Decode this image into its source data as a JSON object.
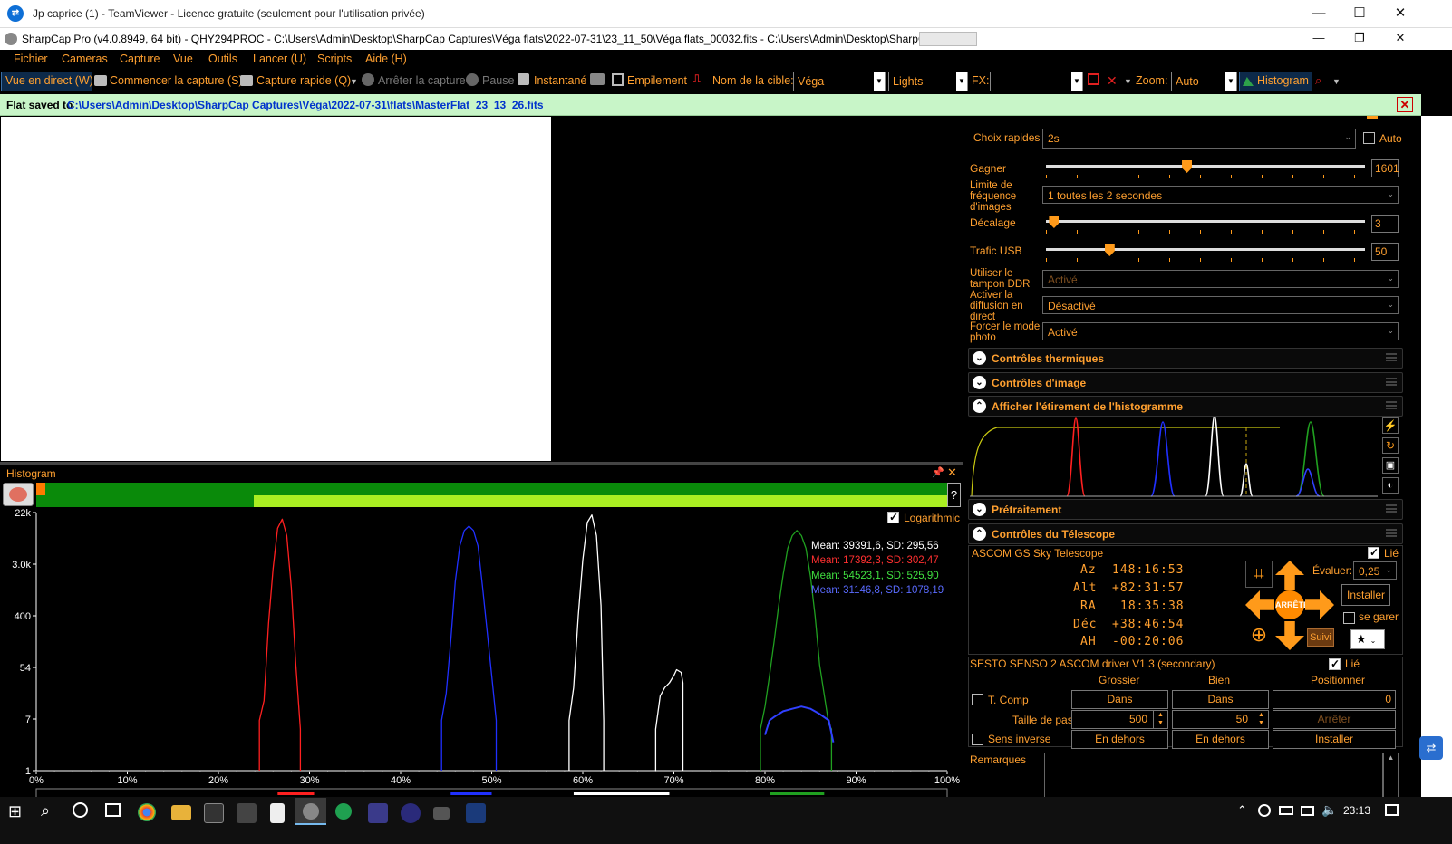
{
  "teamviewer": {
    "title": "Jp caprice (1) - TeamViewer - Licence gratuite (seulement pour l'utilisation privée)",
    "min": "—",
    "max": "☐",
    "close": "✕"
  },
  "sharpcap": {
    "title": "SharpCap Pro (v4.0.8949, 64 bit) - QHY294PROC - C:\\Users\\Admin\\Desktop\\SharpCap Captures\\Véga flats\\2022-07-31\\23_11_50\\Véga flats_00032.fits - C:\\Users\\Admin\\Desktop\\SharpCap Captu"
  },
  "menu": [
    "Fichier",
    "Cameras",
    "Capture",
    "Vue",
    "Outils",
    "Lancer (U)",
    "Scripts",
    "Aide (H)"
  ],
  "toolbar": {
    "live": "Vue en direct (W)",
    "start": "Commencer la capture (S)",
    "quick": "Capture rapide (Q)",
    "stop": "Arrêter la capture",
    "pause": "Pause",
    "snapshot": "Instantané",
    "stack": "Empilement",
    "target_label": "Nom de la cible:",
    "target_value": "Véga",
    "frame_type": "Lights",
    "fx_label": "FX:",
    "fx_value": "",
    "zoom_label": "Zoom:",
    "zoom_value": "Auto",
    "histogram": "Histogram"
  },
  "notification": {
    "prefix": "Flat saved to",
    "path": "C:\\Users\\Admin\\Desktop\\SharpCap Captures\\Véga\\2022-07-31\\flats\\MasterFlat_23_13_26.fits"
  },
  "histogram": {
    "title": "Histogram",
    "logarithmic": "Logarithmic",
    "stats": [
      {
        "text": "Mean: 39391,6, SD: 295,56",
        "color": "#ffffff"
      },
      {
        "text": "Mean: 17392,3, SD: 302,47",
        "color": "#ff3030"
      },
      {
        "text": "Mean: 54523,1, SD: 525,90",
        "color": "#40e040"
      },
      {
        "text": "Mean: 31146,8, SD: 1078,19",
        "color": "#5a6bff"
      }
    ],
    "yticks": [
      "22k",
      "3.0k",
      "400",
      "54",
      "7",
      "1"
    ],
    "xticks": [
      "0%",
      "10%",
      "20%",
      "30%",
      "40%",
      "50%",
      "60%",
      "70%",
      "80%",
      "90%",
      "100%"
    ],
    "help": "?"
  },
  "chart_data": {
    "type": "line",
    "xlabel": "",
    "ylabel": "",
    "x_unit": "%",
    "yscale": "log",
    "xlim": [
      0,
      100
    ],
    "ylim": [
      1,
      22000
    ],
    "series": [
      {
        "color": "#ff2020",
        "x": [
          24.5,
          24.5,
          25,
          25.5,
          26,
          26.5,
          27,
          27.5,
          28,
          28.5,
          29,
          29
        ],
        "y": [
          1,
          7,
          15,
          300,
          2500,
          12000,
          17000,
          9000,
          1200,
          60,
          5,
          1
        ]
      },
      {
        "color": "#2030ff",
        "x": [
          44.5,
          44.5,
          45,
          45.5,
          46,
          46.5,
          47,
          47.5,
          48,
          48.5,
          49,
          50,
          50.5,
          50.5
        ],
        "y": [
          1,
          7,
          20,
          150,
          1500,
          6000,
          11000,
          13000,
          11000,
          6000,
          1200,
          40,
          7,
          1
        ]
      },
      {
        "color": "#ffffff",
        "x": [
          58.5,
          58.5,
          59,
          59.5,
          60,
          60.5,
          61,
          61.5,
          62,
          62.3,
          62.3
        ],
        "y": [
          1,
          7,
          25,
          400,
          3500,
          15000,
          20000,
          9000,
          600,
          7,
          1
        ]
      },
      {
        "color": "#ffffff",
        "x": [
          68,
          68,
          68.5,
          69,
          69.5,
          70,
          70.3,
          70.8,
          71,
          71,
          71
        ],
        "y": [
          1,
          5,
          18,
          25,
          30,
          40,
          50,
          45,
          30,
          8,
          1
        ]
      },
      {
        "color": "#20a020",
        "x": [
          79.5,
          79.5,
          80,
          80.5,
          81,
          81.5,
          82,
          82.5,
          83,
          83.5,
          84,
          84.5,
          85,
          85.5,
          86,
          87,
          87.3,
          87.3
        ],
        "y": [
          1,
          5,
          12,
          40,
          150,
          600,
          2000,
          5500,
          9000,
          11000,
          9000,
          5500,
          1800,
          400,
          60,
          6,
          5,
          1
        ]
      },
      {
        "color": "#3040ff",
        "x": [
          80,
          80.5,
          81,
          82,
          83,
          84,
          85,
          86,
          87,
          87.5
        ],
        "y": [
          4,
          7,
          8,
          10,
          11,
          12,
          11,
          9,
          7,
          3
        ]
      }
    ]
  },
  "right_panel": {
    "quick_choice_label": "Choix rapides",
    "quick_choice_value": "2s",
    "auto_label": "Auto",
    "gain_label": "Gagner",
    "gain_value": "1601",
    "gain_pos": 0.44,
    "fps_label": "Limite de fréquence d'images",
    "fps_value": "1 toutes les 2 secondes",
    "offset_label": "Décalage",
    "offset_value": "3",
    "offset_pos": 0.01,
    "usb_label": "Trafic USB",
    "usb_value": "50",
    "usb_pos": 0.19,
    "ddr_label": "Utiliser le tampon DDR",
    "ddr_value": "Activé",
    "stream_label": "Activer la diffusion en direct",
    "stream_value": "Désactivé",
    "photo_label": "Forcer le mode photo",
    "photo_value": "Activé",
    "sections": [
      "Contrôles thermiques",
      "Contrôles d'image",
      "Afficher l'étirement de l'histogramme",
      "Prétraitement",
      "Contrôles du Télescope"
    ],
    "telescope": {
      "name": "ASCOM GS Sky Telescope",
      "linked": "Lié",
      "rows": [
        {
          "k": "Az",
          "v": "148:16:53"
        },
        {
          "k": "Alt",
          "v": "+82:31:57"
        },
        {
          "k": "RA",
          "v": "18:35:38"
        },
        {
          "k": "Déc",
          "v": "+38:46:54"
        },
        {
          "k": "AH",
          "v": "-00:20:06"
        }
      ],
      "rate_label": "Évaluer:",
      "rate_value": "0,25",
      "install": "Installer",
      "park": "se garer",
      "stop": "ARRÊTE",
      "track": "Suivi"
    },
    "focuser": {
      "name": "SESTO SENSO 2 ASCOM driver V1.3 (secondary)",
      "linked": "Lié",
      "col_coarse": "Grossier",
      "col_fine": "Bien",
      "col_pos": "Positionner",
      "tcomp": "T. Comp",
      "in1": "Dans",
      "in2": "Dans",
      "pos_value": "0",
      "step_label": "Taille de pas",
      "step1": "500",
      "step2": "50",
      "stop": "Arrêter",
      "reverse": "Sens inverse",
      "out1": "En dehors",
      "out2": "En dehors",
      "install": "Installer"
    },
    "remarks": "Remarques"
  },
  "taskbar": {
    "time": "23:13"
  },
  "colors": {
    "accent": "#ffa030",
    "panel": "#000000",
    "green_bar": "#0a8a0a",
    "lime_bar": "#aaee22"
  }
}
